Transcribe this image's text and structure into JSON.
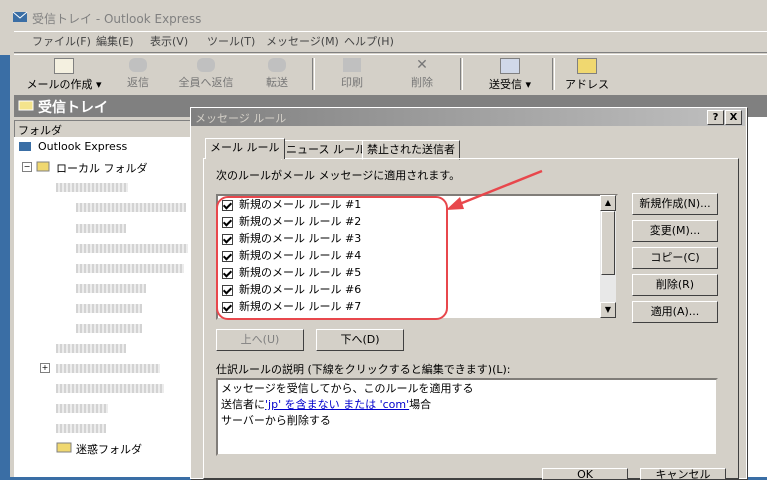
{
  "window": {
    "title": "受信トレイ - Outlook Express"
  },
  "menu": [
    "ファイル(F)",
    "編集(E)",
    "表示(V)",
    "ツール(T)",
    "メッセージ(M)",
    "ヘルプ(H)"
  ],
  "toolbar": {
    "create": "メールの作成",
    "reply": "返信",
    "reply_all": "全員へ返信",
    "forward": "転送",
    "print": "印刷",
    "delete": "削除",
    "send_receive": "送受信",
    "address": "アドレス"
  },
  "folder_bar": {
    "title": "受信トレイ"
  },
  "folder_pane": {
    "header": "フォルダ",
    "root": "Outlook Express",
    "local": "ローカル フォルダ",
    "junk": "迷惑フォルダ"
  },
  "dialog": {
    "title": "メッセージ ルール",
    "help": "?",
    "close": "X",
    "tabs": [
      "メール ルール",
      "ニュース ルール",
      "禁止された送信者"
    ],
    "rules_caption": "次のルールがメール メッセージに適用されます。",
    "rules": [
      "新規のメール ルール #1",
      "新規のメール ルール #2",
      "新規のメール ルール #3",
      "新規のメール ルール #4",
      "新規のメール ルール #5",
      "新規のメール ルール #6",
      "新規のメール ルール #7"
    ],
    "buttons": {
      "new": "新規作成(N)...",
      "modify": "変更(M)...",
      "copy": "コピー(C)",
      "remove": "削除(R)",
      "apply": "適用(A)...",
      "move_up": "上へ(U)",
      "move_down": "下へ(D)",
      "ok": "OK",
      "cancel": "キャンセル"
    },
    "desc_caption": "仕訳ルールの説明 (下線をクリックすると編集できます)(L):",
    "desc_line1": "メッセージを受信してから、このルールを適用する",
    "desc_line2_pre": "送信者に",
    "desc_line2_link1": "'jp' を含まない または 'com'",
    "desc_line2_post": "場合",
    "desc_line3": "サーバーから削除する"
  },
  "colors": {
    "accent": "#e8474c",
    "title_inactive": "#808080",
    "link": "#0000cc"
  }
}
